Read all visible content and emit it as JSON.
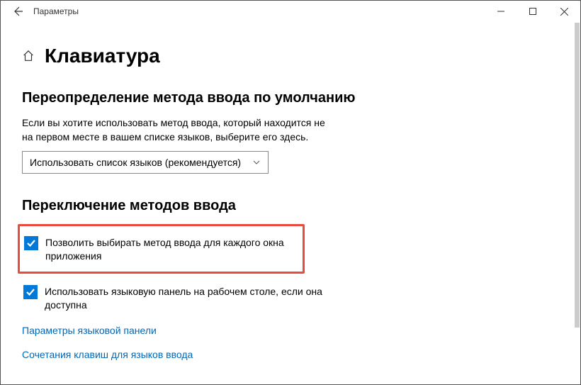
{
  "titlebar": {
    "title": "Параметры"
  },
  "page": {
    "title": "Клавиатура"
  },
  "section1": {
    "title": "Переопределение метода ввода по умолчанию",
    "description": "Если вы хотите использовать метод ввода, который находится не на первом месте в вашем списке языков, выберите его здесь.",
    "comboValue": "Использовать список языков (рекомендуется)"
  },
  "section2": {
    "title": "Переключение методов ввода",
    "checkbox1": "Позволить выбирать метод ввода для каждого окна приложения",
    "checkbox2": "Использовать языковую панель на рабочем столе, если она доступна"
  },
  "links": {
    "languageBarOptions": "Параметры языковой панели",
    "inputLanguageHotkeys": "Сочетания клавиш для языков ввода"
  }
}
